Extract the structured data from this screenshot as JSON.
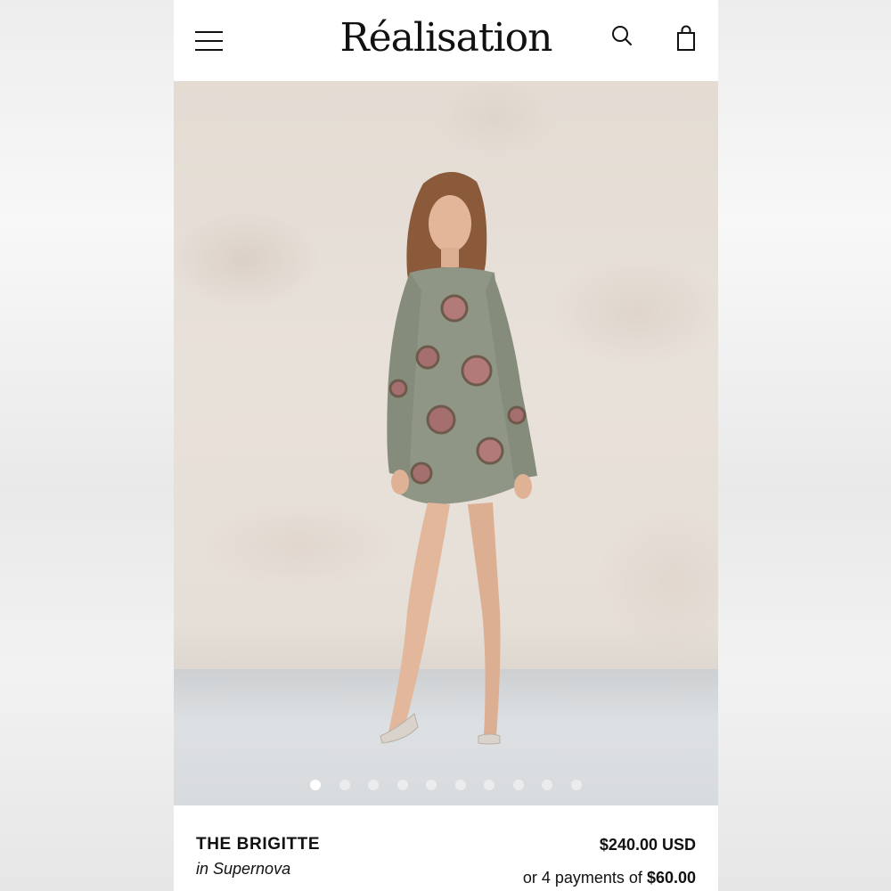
{
  "header": {
    "logo": "Réalisation",
    "menu_icon": "hamburger-menu-icon",
    "search_icon": "search-icon",
    "bag_icon": "shopping-bag-icon"
  },
  "carousel": {
    "total_slides": 10,
    "active_index": 0
  },
  "product": {
    "name": "THE BRIGITTE",
    "variant": "in Supernova",
    "price": "$240.00 USD",
    "installments_prefix": "or 4 payments of ",
    "installments_amount": "$60.00"
  }
}
